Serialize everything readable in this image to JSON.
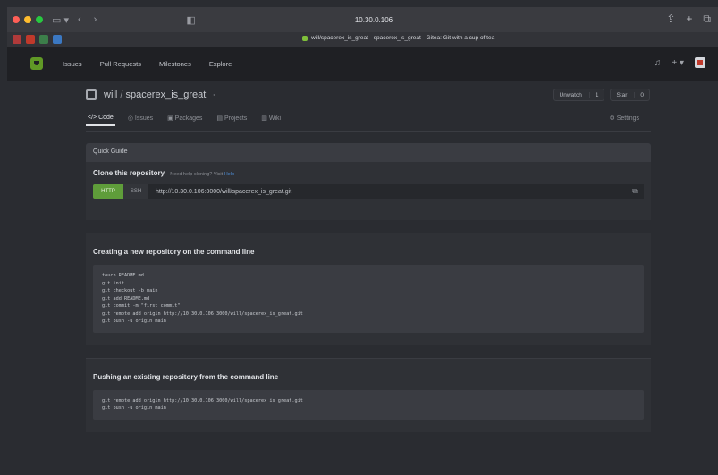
{
  "browser": {
    "url": "10.30.0.106",
    "tab_title": "will/spacerex_is_great - spacerex_is_great - Gitea: Git with a cup of tea"
  },
  "nav": {
    "items": [
      "Issues",
      "Pull Requests",
      "Milestones",
      "Explore"
    ],
    "notifications_icon": "bell-icon",
    "create_label": "+ ▾",
    "colors": {
      "bar": "#1f2024",
      "logo": "#609926"
    }
  },
  "repo": {
    "owner": "will",
    "name": "spacerex_is_great",
    "unwatch_label": "Unwatch",
    "unwatch_count": "1",
    "star_label": "Star",
    "star_count": "0",
    "tabs": [
      "Code",
      "Issues",
      "Packages",
      "Projects",
      "Wiki"
    ],
    "settings_label": "Settings"
  },
  "quick": {
    "header": "Quick Guide",
    "clone_title": "Clone this repository",
    "clone_help_prefix": "Need help cloning? Visit",
    "clone_help_link": "Help",
    "http_label": "HTTP",
    "ssh_label": "SSH",
    "clone_url": "http://10.30.0.106:3000/will/spacerex_is_great.git",
    "new_title": "Creating a new repository on the command line",
    "new_code": "touch README.md\ngit init\ngit checkout -b main\ngit add README.md\ngit commit -m \"first commit\"\ngit remote add origin http://10.30.0.106:3000/will/spacerex_is_great.git\ngit push -u origin main",
    "push_title": "Pushing an existing repository from the command line",
    "push_code": "git remote add origin http://10.30.0.106:3000/will/spacerex_is_great.git\ngit push -u origin main"
  }
}
